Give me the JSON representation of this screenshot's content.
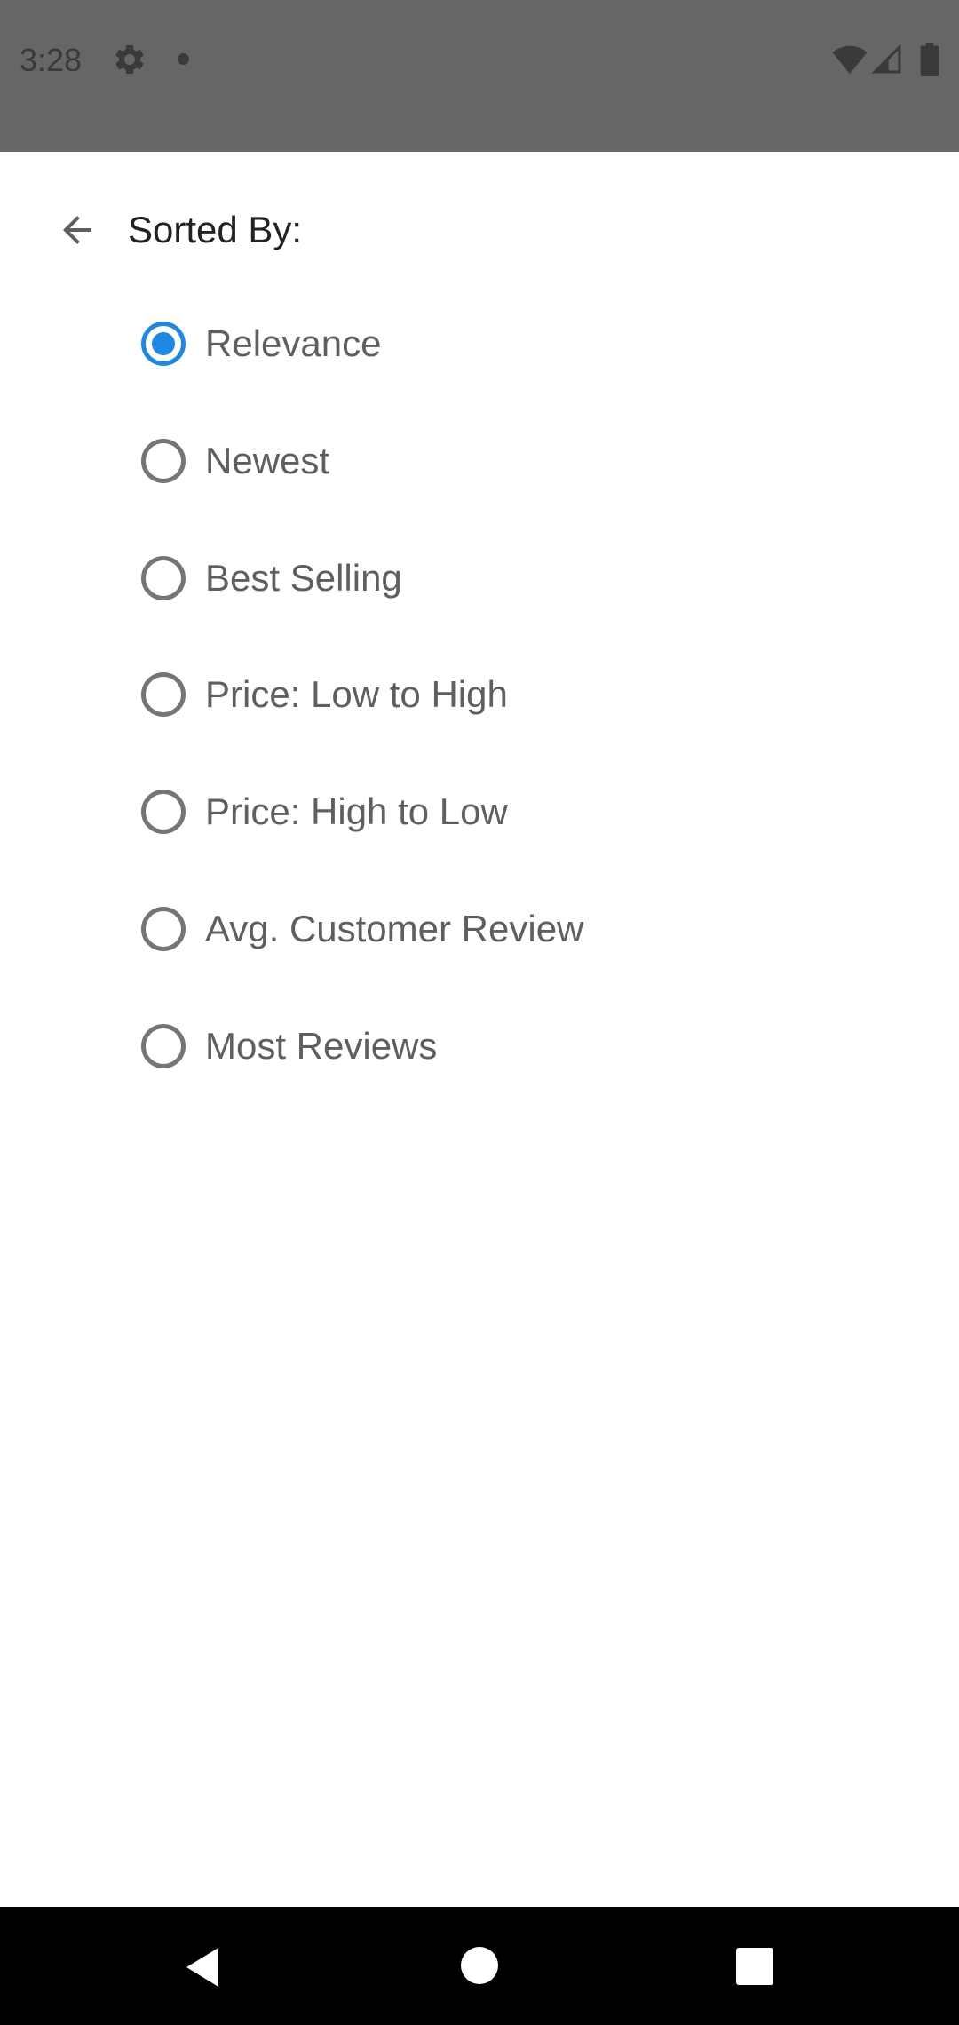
{
  "status_bar": {
    "time": "3:28",
    "icons": [
      "gear-icon",
      "notification-dot-icon",
      "wifi-icon",
      "signal-icon",
      "battery-icon"
    ]
  },
  "header": {
    "title": "Sorted By:",
    "back_icon": "arrow-back-icon"
  },
  "sort_options": [
    {
      "label": "Relevance",
      "selected": true
    },
    {
      "label": "Newest",
      "selected": false
    },
    {
      "label": "Best Selling",
      "selected": false
    },
    {
      "label": "Price: Low to High",
      "selected": false
    },
    {
      "label": "Price: High to Low",
      "selected": false
    },
    {
      "label": "Avg. Customer Review",
      "selected": false
    },
    {
      "label": "Most Reviews",
      "selected": false
    }
  ],
  "colors": {
    "status_bar": "#666666",
    "accent": "#1e88e5",
    "radio_unchecked": "#757575",
    "nav_bar": "#000000"
  },
  "nav_bar": {
    "icons": [
      "nav-back-icon",
      "nav-home-icon",
      "nav-recents-icon"
    ]
  }
}
